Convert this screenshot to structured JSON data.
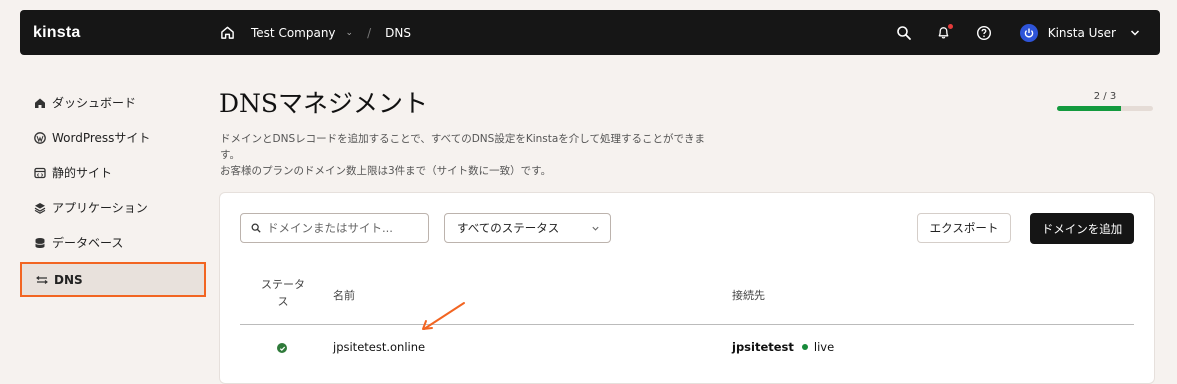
{
  "topbar": {
    "logo": "kinsta",
    "company": "Test Company",
    "section": "DNS",
    "separator": "/",
    "user_name": "Kinsta User",
    "icons": [
      "home-icon",
      "search-icon",
      "bell-icon",
      "help-icon",
      "power-icon",
      "chevron-down-icon"
    ]
  },
  "sidebar": {
    "items": [
      {
        "label": "ダッシュボード",
        "icon": "home-icon"
      },
      {
        "label": "WordPressサイト",
        "icon": "wordpress-icon"
      },
      {
        "label": "静的サイト",
        "icon": "static-site-icon"
      },
      {
        "label": "アプリケーション",
        "icon": "layers-icon"
      },
      {
        "label": "データベース",
        "icon": "database-icon"
      },
      {
        "label": "DNS",
        "icon": "dns-icon",
        "active": true
      }
    ]
  },
  "page": {
    "title": "DNSマネジメント",
    "desc_line1": "ドメインとDNSレコードを追加することで、すべてのDNS設定をKinstaを介して処理することができま",
    "desc_line2": "す。",
    "desc_line3": "お客様のプランのドメイン数上限は3件まで（サイト数に一致）です。"
  },
  "progress": {
    "label": "2 / 3",
    "value": 0.667,
    "color": "#139a3e"
  },
  "toolbar": {
    "search_placeholder": "ドメインまたはサイト...",
    "status_select": "すべてのステータス",
    "export_label": "エクスポート",
    "add_label": "ドメインを追加"
  },
  "table": {
    "headers": {
      "status_line1": "ステータ",
      "status_line2": "ス",
      "name": "名前",
      "connected": "接続先"
    },
    "rows": [
      {
        "status": "active",
        "name": "jpsitetest.online",
        "site": "jpsitetest",
        "env": "live"
      }
    ]
  },
  "colors": {
    "accent": "#f26522",
    "topbar": "#161616",
    "success": "#139a3e"
  }
}
